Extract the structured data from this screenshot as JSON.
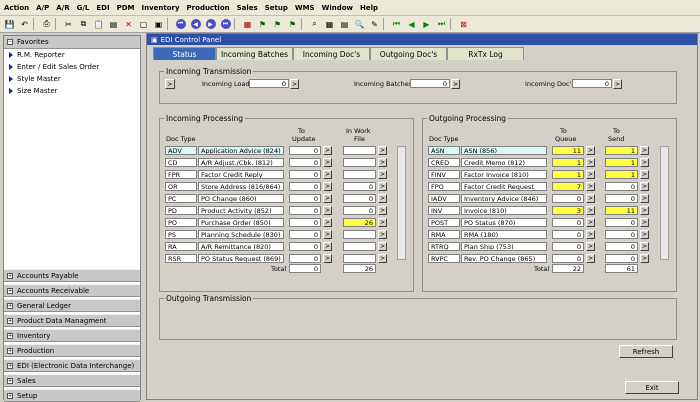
{
  "menu": [
    "Action",
    "A/P",
    "A/R",
    "G/L",
    "EDI",
    "PDM",
    "Inventory",
    "Production",
    "Sales",
    "Setup",
    "WMS",
    "Window",
    "Help"
  ],
  "panel_title": "EDI Control Panel",
  "tabs": [
    "Status",
    "Incoming Batches",
    "Incoming Doc's",
    "Outgoing Doc's",
    "RxTx Log"
  ],
  "sidebar": {
    "favorites_label": "Favorites",
    "favorites": [
      "R.M. Reporter",
      "Enter / Edit  Sales Order",
      "Style Master",
      "Size Master"
    ],
    "sections": [
      "Accounts Payable",
      "Accounts Receivable",
      "General Ledger",
      "Product Data Managment",
      "Inventory",
      "Production",
      "EDI (Electronic Data Interchange)",
      "Sales",
      "Setup"
    ]
  },
  "incoming_transmission": {
    "title": "Incoming Transmission",
    "arrow": ">",
    "load_label": "Incoming Load",
    "load_value": "0",
    "batches_label": "Incoming Batches",
    "batches_value": "0",
    "docs_label": "Incoming Doc's",
    "docs_value": "0"
  },
  "incoming_processing": {
    "title": "Incoming Processing",
    "col_doctype": "Doc Type",
    "col_to_update_1": "To",
    "col_to_update_2": "Update",
    "col_inwork_1": "In Work",
    "col_inwork_2": "File",
    "arrow": ">",
    "rows": [
      {
        "code": "ADV",
        "name": "Application Advice (824)",
        "update": "0",
        "work": ""
      },
      {
        "code": "CD",
        "name": "A/R Adjust./Cbk. (812)",
        "update": "0",
        "work": ""
      },
      {
        "code": "FPR",
        "name": "Factor Credit Reply",
        "update": "0",
        "work": ""
      },
      {
        "code": "OR",
        "name": "Store Address (816/864)",
        "update": "0",
        "work": "0"
      },
      {
        "code": "PC",
        "name": "PO Change (860)",
        "update": "0",
        "work": "0"
      },
      {
        "code": "PD",
        "name": "Product Activity (852)",
        "update": "0",
        "work": "0"
      },
      {
        "code": "PO",
        "name": "Purchase Order (850)",
        "update": "0",
        "work": "26"
      },
      {
        "code": "PS",
        "name": "Planning Schedule (830)",
        "update": "0",
        "work": ""
      },
      {
        "code": "RA",
        "name": "A/R Remittance (820)",
        "update": "0",
        "work": ""
      },
      {
        "code": "RSR",
        "name": "PO Status Request (869)",
        "update": "0",
        "work": ""
      }
    ],
    "total_label": "Total",
    "total_update": "0",
    "total_work": "26"
  },
  "outgoing_processing": {
    "title": "Outgoing Processing",
    "col_doctype": "Doc Type",
    "col_queue_1": "To",
    "col_queue_2": "Queue",
    "col_send_1": "To",
    "col_send_2": "Send",
    "arrow": ">",
    "rows": [
      {
        "code": "ASN",
        "name": "ASN (856)",
        "queue": "11",
        "send": "1"
      },
      {
        "code": "CRED",
        "name": "Credit Memo (812)",
        "queue": "1",
        "send": "1"
      },
      {
        "code": "FINV",
        "name": "Factor Invoice (810)",
        "queue": "1",
        "send": "1"
      },
      {
        "code": "FPO",
        "name": "Factor Credit Request",
        "queue": "7",
        "send": "0"
      },
      {
        "code": "IADV",
        "name": "Inventory Advice (846)",
        "queue": "0",
        "send": "0"
      },
      {
        "code": "INV",
        "name": "Invoice (810)",
        "queue": "3",
        "send": "11"
      },
      {
        "code": "POST",
        "name": "PO Status (870)",
        "queue": "0",
        "send": "0"
      },
      {
        "code": "RMA",
        "name": "RMA (180)",
        "queue": "0",
        "send": "0"
      },
      {
        "code": "RTRQ",
        "name": "Plan Ship (753)",
        "queue": "0",
        "send": "0"
      },
      {
        "code": "RVPC",
        "name": "Rev. PO Change (865)",
        "queue": "0",
        "send": "0"
      }
    ],
    "total_label": "Total",
    "total_queue": "22",
    "total_send": "61"
  },
  "outgoing_transmission": {
    "title": "Outgoing Transmission"
  },
  "buttons": {
    "refresh": "Refresh",
    "exit": "Exit"
  }
}
